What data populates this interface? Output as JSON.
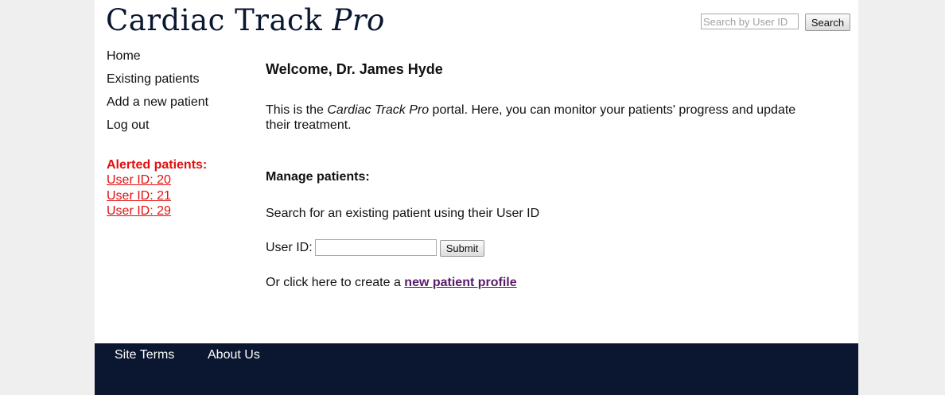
{
  "header": {
    "logo_main": "Cardiac Track ",
    "logo_emph": "Pro",
    "search_placeholder": "Search by User ID",
    "search_button": "Search"
  },
  "nav": {
    "items": [
      {
        "label": "Home"
      },
      {
        "label": "Existing patients"
      },
      {
        "label": "Add a new patient"
      },
      {
        "label": "Log out"
      }
    ]
  },
  "alerts": {
    "title": "Alerted patients:",
    "items": [
      {
        "label": "User ID: 20"
      },
      {
        "label": "User ID: 21"
      },
      {
        "label": "User ID: 29"
      }
    ],
    "color": "#e01010"
  },
  "main": {
    "welcome": "Welcome, Dr. James Hyde",
    "intro_prefix": "This is the ",
    "intro_emph": "Cardiac Track Pro",
    "intro_suffix": " portal. Here, you can monitor your patients' progress and update their treatment.",
    "manage_title": "Manage patients:",
    "search_hint": "Search for an existing patient using their User ID",
    "userid_label": "User ID:",
    "userid_value": "",
    "submit_button": "Submit",
    "create_prefix": "Or click here to create a ",
    "create_link": "new patient profile"
  },
  "footer": {
    "links": [
      {
        "label": "Site Terms"
      },
      {
        "label": "About Us"
      }
    ],
    "background": "#0b1730"
  }
}
